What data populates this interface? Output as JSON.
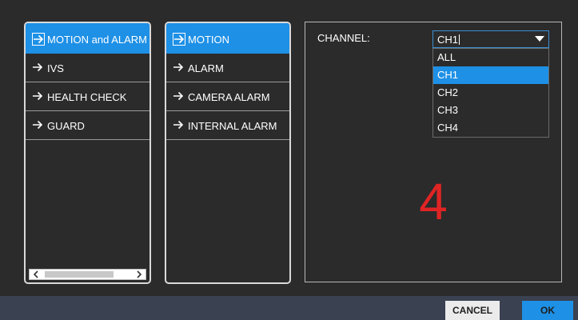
{
  "left_menu": {
    "items": [
      {
        "label": "MOTION and ALARM",
        "selected": true
      },
      {
        "label": "IVS",
        "selected": false
      },
      {
        "label": "HEALTH CHECK",
        "selected": false
      },
      {
        "label": "GUARD",
        "selected": false
      }
    ]
  },
  "sub_menu": {
    "items": [
      {
        "label": "MOTION",
        "selected": true
      },
      {
        "label": "ALARM",
        "selected": false
      },
      {
        "label": "CAMERA ALARM",
        "selected": false
      },
      {
        "label": "INTERNAL ALARM",
        "selected": false
      }
    ]
  },
  "channel": {
    "label": "CHANNEL:",
    "value": "CH1",
    "options": [
      "ALL",
      "CH1",
      "CH2",
      "CH3",
      "CH4"
    ],
    "selected_option": "CH1"
  },
  "annotation": "4",
  "footer": {
    "cancel_label": "CANCEL",
    "ok_label": "OK"
  },
  "colors": {
    "background": "#2b2b2b",
    "accent": "#1e90e6",
    "footer": "#3a4150",
    "annotation": "#e02424"
  }
}
